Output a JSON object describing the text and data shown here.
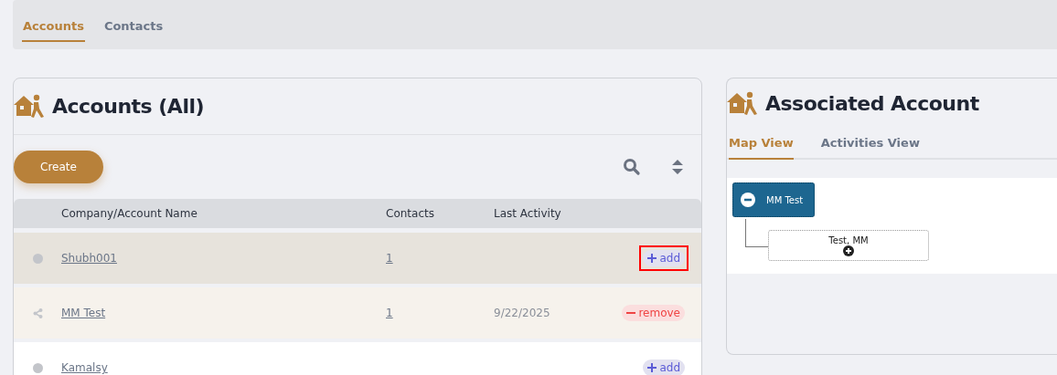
{
  "top_tabs": [
    {
      "label": "Accounts",
      "selected": true
    },
    {
      "label": "Contacts",
      "selected": false
    }
  ],
  "accounts": {
    "title": "Accounts (All)",
    "create_button": "Create",
    "columns": [
      "Company/Account Name",
      "Contacts",
      "Last Activity"
    ],
    "rows": [
      {
        "kind": "dot",
        "name": "Shubh001",
        "contacts": "1",
        "last_activity": "",
        "action": {
          "kind": "add",
          "label": "add"
        },
        "selected": true,
        "highlighted": true
      },
      {
        "kind": "share",
        "name": "MM Test",
        "contacts": "1",
        "last_activity": "9/22/2025",
        "action": {
          "kind": "remove",
          "label": "remove"
        },
        "selected": false,
        "highlighted": false
      },
      {
        "kind": "dot",
        "name": "Kamalsy",
        "contacts": "",
        "last_activity": "",
        "action": {
          "kind": "add",
          "label": "add"
        },
        "selected": false,
        "highlighted": false
      }
    ]
  },
  "associated": {
    "title": "Associated Account",
    "tabs": [
      {
        "label": "Map View",
        "selected": true
      },
      {
        "label": "Activities View",
        "selected": false
      }
    ],
    "map": {
      "root": {
        "label": "MM Test",
        "expanded": true,
        "children": [
          {
            "label": "Test, MM",
            "expanded": false
          }
        ]
      }
    }
  }
}
